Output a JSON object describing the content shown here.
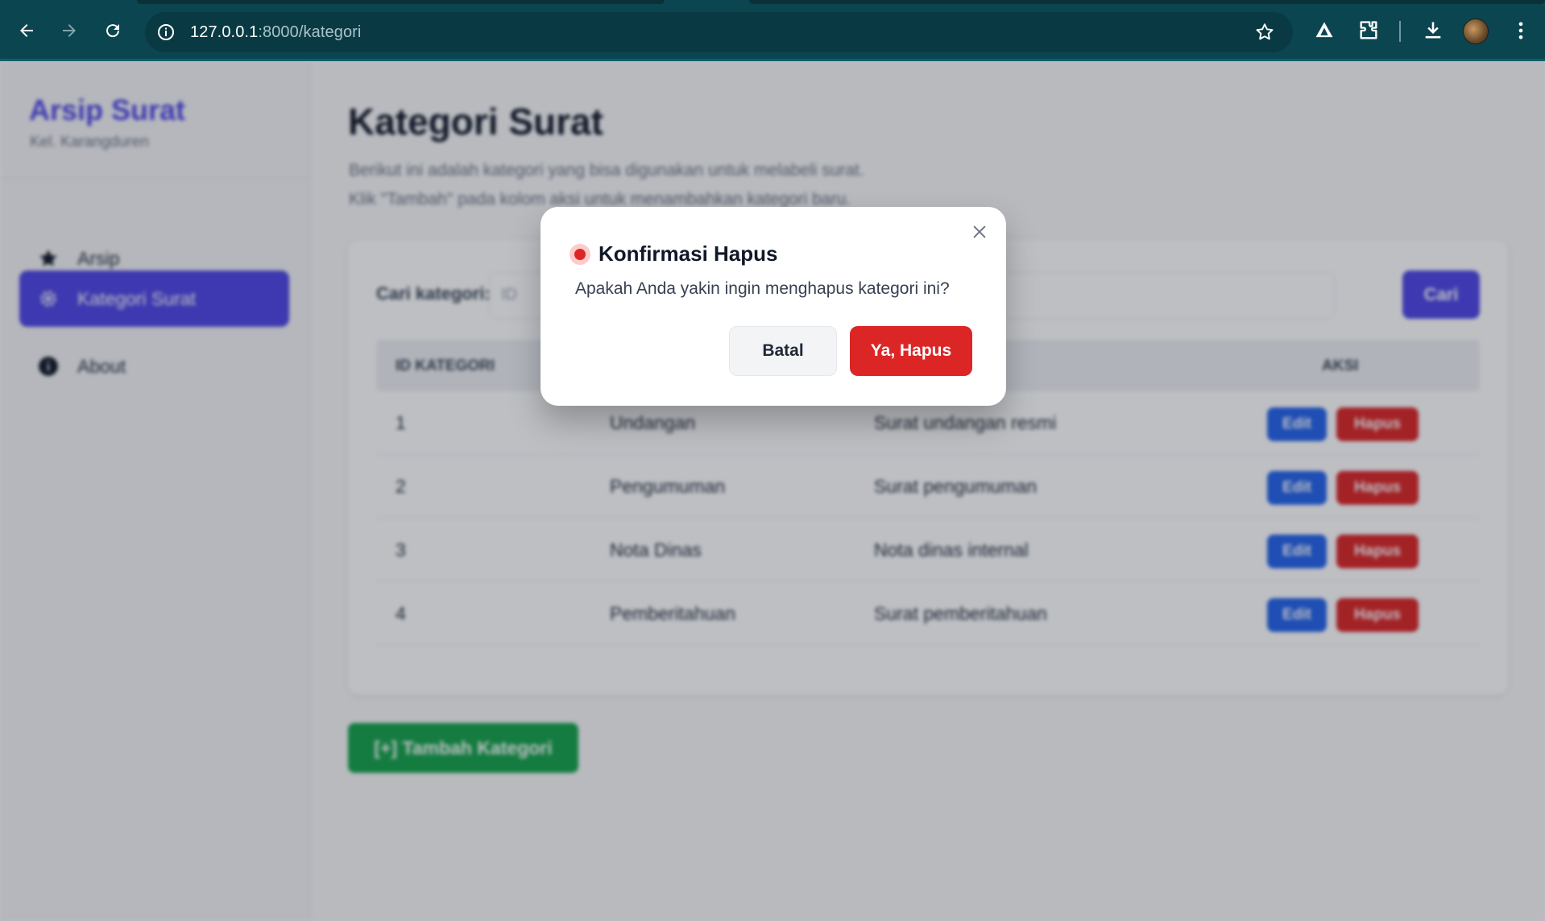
{
  "browser": {
    "url_host": "127.0.0.1",
    "url_path": ":8000/kategori"
  },
  "sidebar": {
    "brand": "Arsip Surat",
    "subtitle": "Kel. Karangduren",
    "items": [
      {
        "label": "Arsip",
        "icon": "star-icon",
        "active": false
      },
      {
        "label": "Kategori Surat",
        "icon": "gear-icon",
        "active": true
      },
      {
        "label": "About",
        "icon": "info-icon",
        "active": false
      }
    ]
  },
  "main": {
    "title": "Kategori Surat",
    "description_line1": "Berikut ini adalah kategori yang bisa digunakan untuk melabeli surat.",
    "description_line2": "Klik \"Tambah\" pada kolom aksi untuk menambahkan kategori baru.",
    "search_label": "Cari kategori:",
    "search_placeholder": "ID",
    "search_button": "Cari",
    "table": {
      "headers": [
        "ID KATEGORI",
        "",
        "",
        "AKSI"
      ],
      "rows": [
        {
          "id": "1",
          "name": "Undangan",
          "desc": "Surat undangan resmi"
        },
        {
          "id": "2",
          "name": "Pengumuman",
          "desc": "Surat pengumuman"
        },
        {
          "id": "3",
          "name": "Nota Dinas",
          "desc": "Nota dinas internal"
        },
        {
          "id": "4",
          "name": "Pemberitahuan",
          "desc": "Surat pemberitahuan"
        }
      ],
      "edit_label": "Edit",
      "delete_label": "Hapus"
    },
    "add_button": "[+] Tambah Kategori"
  },
  "modal": {
    "title": "Konfirmasi Hapus",
    "message": "Apakah Anda yakin ingin menghapus kategori ini?",
    "cancel_label": "Batal",
    "confirm_label": "Ya, Hapus"
  },
  "colors": {
    "chrome": "#0b4550",
    "accent": "#4f46e5",
    "danger": "#dc2626",
    "edit": "#2563eb",
    "success": "#16a34a"
  }
}
